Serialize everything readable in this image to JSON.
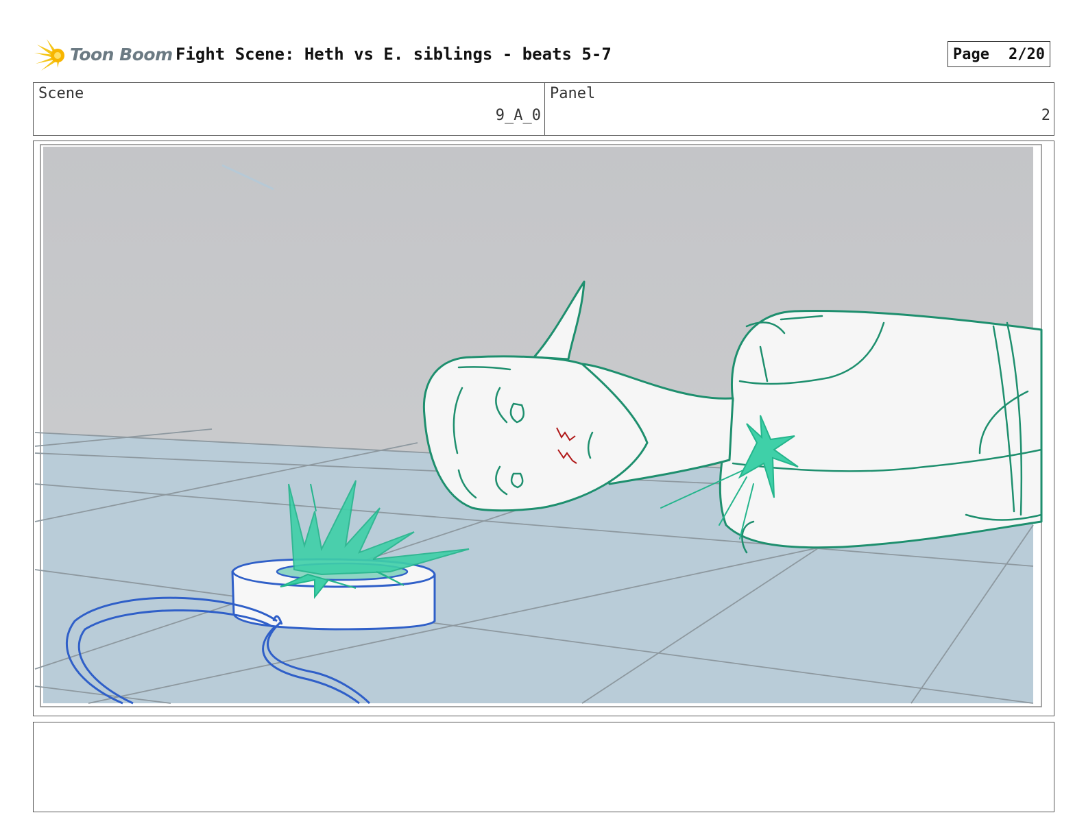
{
  "header": {
    "logo_text": "Toon Boom",
    "title": "Fight Scene: Heth vs E. siblings - beats 5-7",
    "page_label": "Page",
    "page_value": "2/20"
  },
  "info": {
    "scene_label": "Scene",
    "scene_value": "9_A_0",
    "panel_label": "Panel",
    "panel_value": "2"
  },
  "colors": {
    "character_line": "#1e8f6e",
    "splash": "#3fd0a8",
    "device_line": "#2f5fc8",
    "wall": "#c7c8ca",
    "floor": "#b9ccd8",
    "blood": "#b01818"
  },
  "notes": {
    "text": ""
  }
}
